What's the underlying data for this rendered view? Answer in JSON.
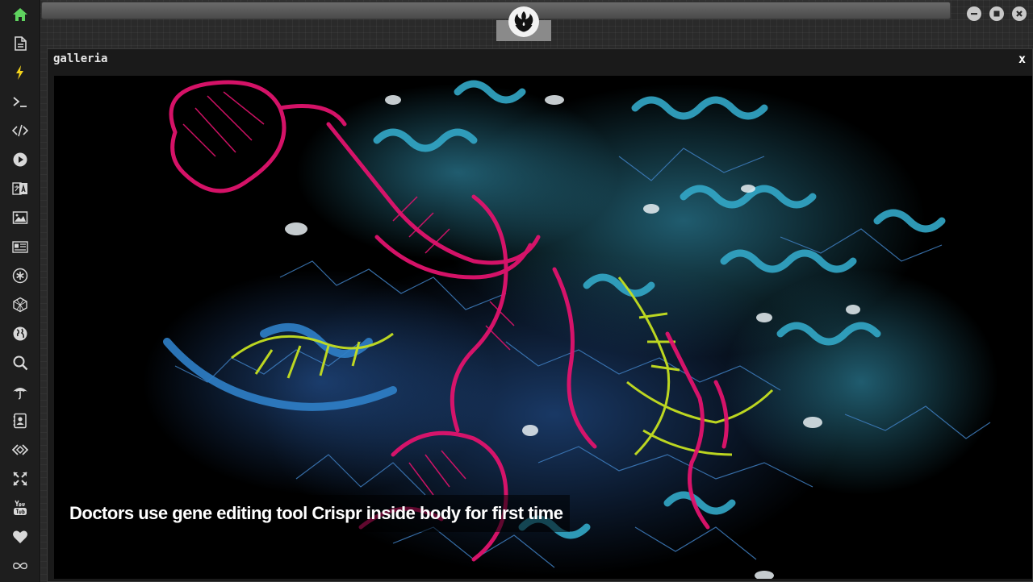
{
  "sidebar": {
    "items": [
      {
        "name": "home-icon",
        "color": "#5fd35f"
      },
      {
        "name": "document-icon"
      },
      {
        "name": "lightning-icon",
        "color": "#f2d21b"
      },
      {
        "name": "terminal-icon"
      },
      {
        "name": "code-icon"
      },
      {
        "name": "play-icon"
      },
      {
        "name": "translate-icon"
      },
      {
        "name": "image-icon"
      },
      {
        "name": "news-icon"
      },
      {
        "name": "asterisk-icon"
      },
      {
        "name": "cube-icon"
      },
      {
        "name": "globe-icon"
      },
      {
        "name": "search-icon"
      },
      {
        "name": "umbrella-icon"
      },
      {
        "name": "contacts-icon"
      },
      {
        "name": "diamond-code-icon"
      },
      {
        "name": "expand-icon"
      },
      {
        "name": "youtube-icon"
      },
      {
        "name": "heart-icon"
      },
      {
        "name": "infinity-icon"
      }
    ]
  },
  "window": {
    "logo": "rebel-alliance-icon",
    "controls": [
      "minimize-icon",
      "maximize-icon",
      "close-icon"
    ]
  },
  "panel": {
    "title": "galleria",
    "close_label": "x"
  },
  "gallery": {
    "caption": "Doctors use gene editing tool Crispr inside body for first time",
    "image": "crispr-molecule-image"
  },
  "colors": {
    "sidebar_bg": "#1e1e1e",
    "icon": "#d8d8d8",
    "accent_green": "#5fd35f",
    "accent_yellow": "#f2d21b",
    "rna_magenta": "#e0136d",
    "protein_cyan": "#2a9cbf",
    "dna_yellow": "#c6e020"
  }
}
